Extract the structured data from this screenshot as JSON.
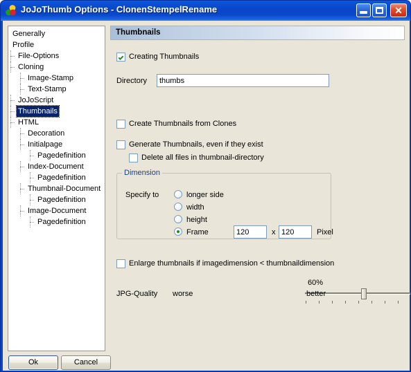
{
  "window": {
    "title": "JoJoThumb Options - ClonenStempelRename",
    "icon": "app-colored-circles-icon",
    "controls": {
      "minimize": "minimize-icon",
      "maximize": "maximize-icon",
      "close": "close-icon"
    }
  },
  "tree": {
    "items": [
      {
        "label": "Generally",
        "depth": 0,
        "selected": false
      },
      {
        "label": "Profile",
        "depth": 0,
        "selected": false
      },
      {
        "label": "File-Options",
        "depth": 1,
        "selected": false
      },
      {
        "label": "Cloning",
        "depth": 1,
        "selected": false
      },
      {
        "label": "Image-Stamp",
        "depth": 2,
        "selected": false
      },
      {
        "label": "Text-Stamp",
        "depth": 2,
        "selected": false
      },
      {
        "label": "JoJoScript",
        "depth": 1,
        "selected": false
      },
      {
        "label": "Thumbnails",
        "depth": 1,
        "selected": true
      },
      {
        "label": "HTML",
        "depth": 1,
        "selected": false
      },
      {
        "label": "Decoration",
        "depth": 2,
        "selected": false
      },
      {
        "label": "Initialpage",
        "depth": 2,
        "selected": false
      },
      {
        "label": "Pagedefinition",
        "depth": 3,
        "selected": false
      },
      {
        "label": "Index-Document",
        "depth": 2,
        "selected": false
      },
      {
        "label": "Pagedefinition",
        "depth": 3,
        "selected": false
      },
      {
        "label": "Thumbnail-Document",
        "depth": 2,
        "selected": false
      },
      {
        "label": "Pagedefinition",
        "depth": 3,
        "selected": false
      },
      {
        "label": "Image-Document",
        "depth": 2,
        "selected": false
      },
      {
        "label": "Pagedefinition",
        "depth": 3,
        "selected": false
      }
    ]
  },
  "panel": {
    "header": "Thumbnails",
    "creating_thumbnails": {
      "label": "Creating Thumbnails",
      "checked": true
    },
    "directory": {
      "label": "Directory",
      "value": "thumbs",
      "placeholder": ""
    },
    "create_from_clones": {
      "label": "Create Thumbnails from Clones",
      "checked": false
    },
    "generate_even_if_exist": {
      "label": "Generate Thumbnails, even if they exist",
      "checked": false
    },
    "delete_all_files": {
      "label": "Delete all files in thumbnail-directory",
      "checked": false
    },
    "dimension": {
      "caption": "Dimension",
      "specify_label": "Specify to",
      "options": [
        {
          "label": "longer side",
          "selected": false
        },
        {
          "label": "width",
          "selected": false
        },
        {
          "label": "height",
          "selected": false
        },
        {
          "label": "Frame",
          "selected": true
        }
      ],
      "frame_width": "120",
      "frame_height": "120",
      "separator": "x",
      "unit": "Pixel"
    },
    "enlarge": {
      "label": "Enlarge thumbnails if imagedimension < thumbnaildimension",
      "checked": false
    },
    "jpg_quality": {
      "label": "JPG-Quality",
      "min_label": "worse",
      "max_label": "better",
      "value_label": "60%",
      "value": 60
    }
  },
  "footer": {
    "ok_label": "Ok",
    "cancel_label": "Cancel"
  }
}
